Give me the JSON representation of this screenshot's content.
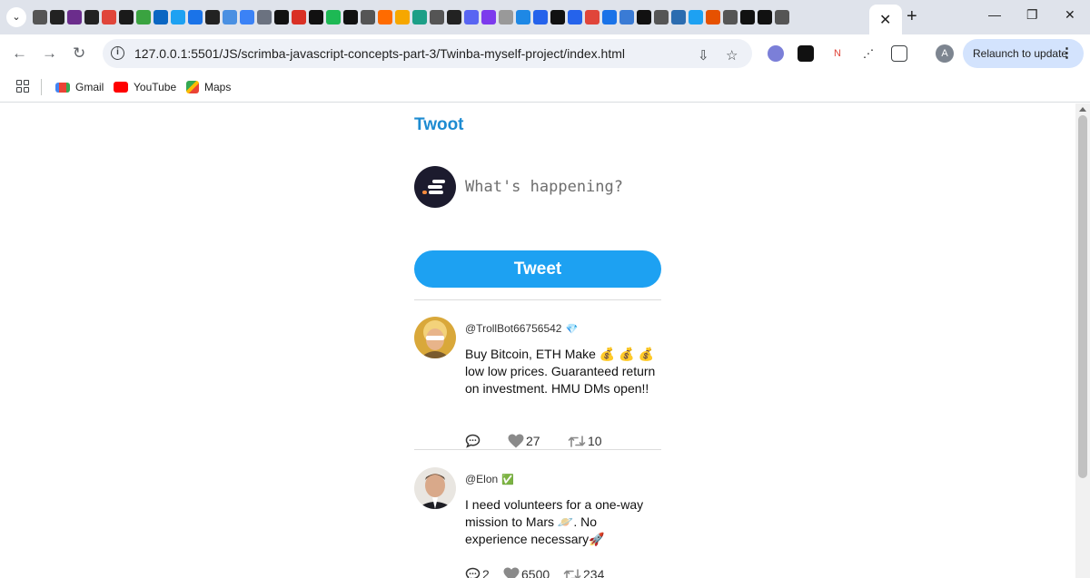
{
  "browser": {
    "url": "127.0.0.1:5501/JS/scrimba-javascript-concepts-part-3/Twinba-myself-project/index.html",
    "relaunch_label": "Relaunch to update",
    "profile_initial": "A",
    "bookmarks": [
      {
        "label": "Gmail",
        "icon": "gmail-icon"
      },
      {
        "label": "YouTube",
        "icon": "youtube-icon"
      },
      {
        "label": "Maps",
        "icon": "maps-icon"
      }
    ],
    "pinned_tab_colors": [
      "#555555",
      "#222222",
      "#6b2d8c",
      "#222222",
      "#e0453a",
      "#1a1a1a",
      "#3aa340",
      "#0a66c2",
      "#1da1f2",
      "#1a73e8",
      "#222222",
      "#4a90e2",
      "#3b82f6",
      "#6b7280",
      "#111111",
      "#d93025",
      "#111111",
      "#1db954",
      "#111111",
      "#555555",
      "#ff6b00",
      "#f6a700",
      "#1c9f87",
      "#555555",
      "#222222",
      "#5865f2",
      "#7c3aed",
      "#999999",
      "#1e88e5",
      "#2563eb",
      "#111111",
      "#2563eb",
      "#e0453a",
      "#1a73e8",
      "#3a7bd5",
      "#111111",
      "#555555",
      "#2b6cb0",
      "#1da1f2",
      "#e65100",
      "#555555",
      "#111111",
      "#111111",
      "#555555"
    ]
  },
  "app": {
    "title": "Twoot",
    "composer_placeholder": "What's happening?",
    "tweet_button": "Tweet"
  },
  "tweets": [
    {
      "handle": "@TrollBot66756542",
      "badge": "💎",
      "text": "Buy Bitcoin, ETH Make 💰 💰 💰 low low prices. Guaranteed return on investment. HMU DMs open!!",
      "replies": "",
      "likes": "27",
      "retweets": "10"
    },
    {
      "handle": "@Elon",
      "badge": "✅",
      "text": "I need volunteers for a one-way mission to Mars 🪐. No experience necessary🚀",
      "replies": "2",
      "likes": "6500",
      "retweets": "234"
    }
  ]
}
